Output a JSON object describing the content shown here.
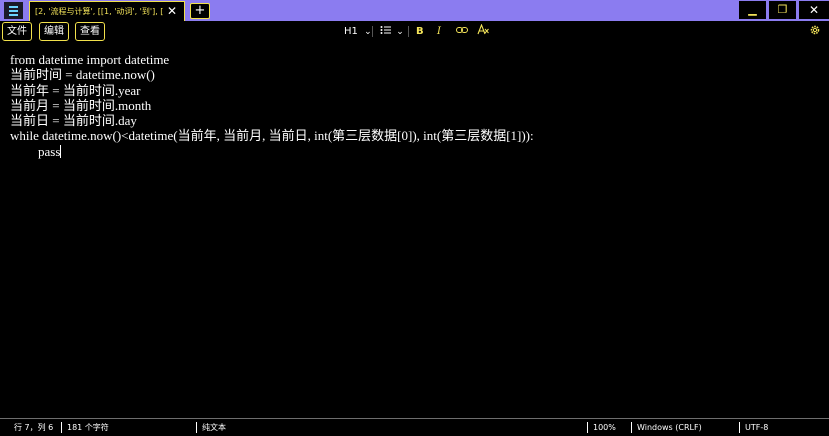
{
  "titlebar": {
    "tab_title": "[2, '流程与计算', [[1, '动词', '到'], [1,",
    "tab_close": "✕",
    "new_tab": "+",
    "minimize": "▁",
    "maximize": "❐",
    "close": "✕"
  },
  "menu": {
    "file": "文件",
    "edit": "编辑",
    "view": "查看"
  },
  "toolbar": {
    "heading": "H1",
    "heading_chevron": "⌄",
    "list_chevron": "⌄",
    "bold": "B",
    "italic": "I"
  },
  "editor": {
    "lines": [
      "from datetime import datetime",
      "当前时间 = datetime.now()",
      "当前年 = 当前时间.year",
      "当前月 = 当前时间.month",
      "当前日 = 当前时间.day",
      "while datetime.now()<datetime(当前年, 当前月, 当前日, int(第三层数据[0]), int(第三层数据[1])):",
      "pass"
    ]
  },
  "status": {
    "position": "行 7，列 6",
    "chars": "181 个字符",
    "format": "纯文本",
    "zoom": "100%",
    "line_ending": "Windows (CRLF)",
    "encoding": "UTF-8"
  },
  "colors": {
    "accent": "#f2e14c",
    "titlebar": "#8b7cf0",
    "background": "#000000"
  }
}
